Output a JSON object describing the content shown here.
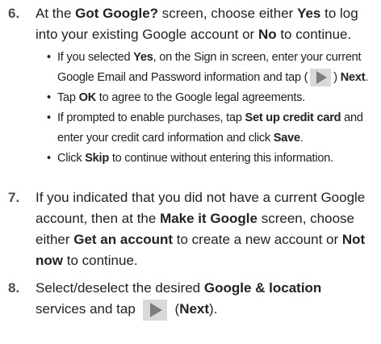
{
  "step6": {
    "number": "6.",
    "t1": "At the ",
    "b1": "Got Google?",
    "t2": " screen, choose either ",
    "b2": "Yes",
    "t3": " to log into your existing Google account or ",
    "b3": "No",
    "t4": " to continue.",
    "bullets": [
      {
        "t1": "If you selected ",
        "b1": "Yes",
        "t2": ", on the Sign in screen, enter your current Google Email and Password information and tap (",
        "t3": ") ",
        "b2": "Next",
        "t4": "."
      },
      {
        "t1": "Tap ",
        "b1": "OK",
        "t2": " to agree to the Google legal agreements."
      },
      {
        "t1": "If prompted to enable purchases, tap ",
        "b1": "Set up credit card",
        "t2": " and enter your credit card information and click ",
        "b2": "Save",
        "t3": "."
      },
      {
        "t1": "Click ",
        "b1": "Skip",
        "t2": " to continue without entering this information."
      }
    ]
  },
  "step7": {
    "number": "7.",
    "t1": "If you indicated that you did not have a current Google account, then at the ",
    "b1": "Make it Google",
    "t2": " screen, choose either ",
    "b2": "Get an account",
    "t3": " to create a new account or ",
    "b3": "Not now",
    "t4": " to continue."
  },
  "step8": {
    "number": "8.",
    "t1": "Select/deselect the desired ",
    "b1": "Google & location",
    "t2": " services and tap ",
    "t3": "(",
    "b2": "Next",
    "t4": ")."
  },
  "bullet_char": "•",
  "icons": {
    "next": "next-arrow-icon"
  },
  "colors": {
    "text": "#222222",
    "number": "#4d4d4d",
    "button_bg": "#d9d9d9",
    "arrow": "#7d7d7d"
  }
}
